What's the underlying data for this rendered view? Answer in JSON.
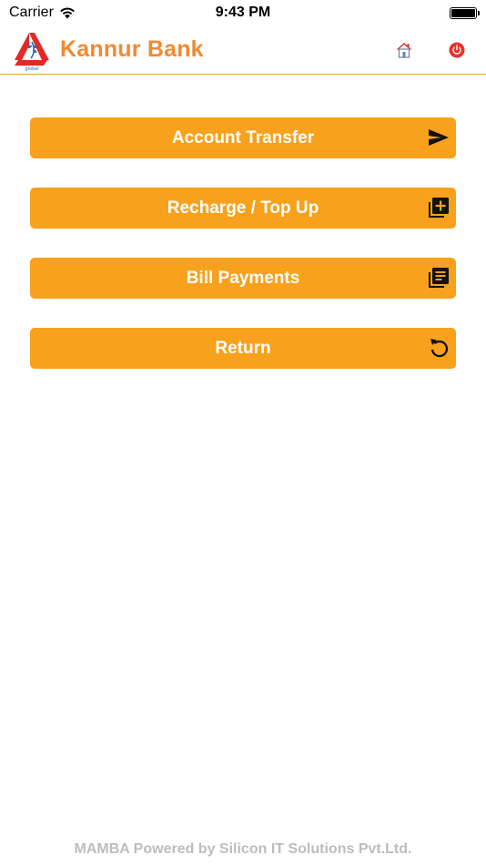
{
  "status_bar": {
    "carrier": "Carrier",
    "time": "9:43 PM"
  },
  "header": {
    "title": "Kannur Bank",
    "logo_text": "global",
    "colors": {
      "title": "#f28a30",
      "logo_red": "#e02a26",
      "home_red": "#d9342b",
      "power_red": "#e8322b"
    }
  },
  "menu": {
    "items": [
      {
        "label": "Account Transfer",
        "icon": "send-icon"
      },
      {
        "label": "Recharge / Top Up",
        "icon": "add-box-icon"
      },
      {
        "label": "Bill Payments",
        "icon": "library-books-icon"
      },
      {
        "label": "Return",
        "icon": "refresh-icon"
      }
    ],
    "button_color": "#f8a11c"
  },
  "footer": {
    "text": "MAMBA Powered by Silicon IT Solutions Pvt.Ltd."
  }
}
